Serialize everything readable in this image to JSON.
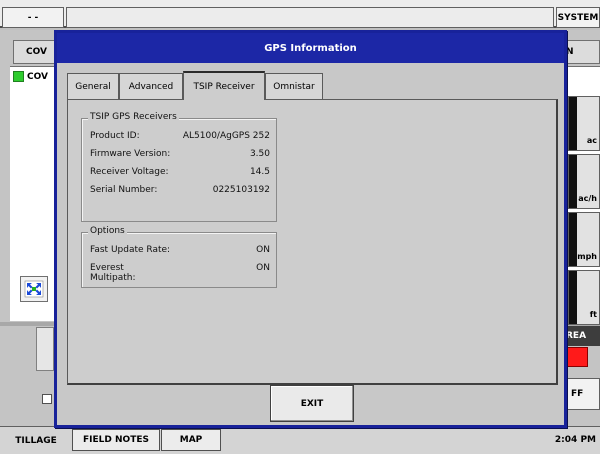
{
  "app": {
    "top_left_label": "- -",
    "system_label": "SYSTEM",
    "background_tab": "COV",
    "coverage_item": "COV",
    "header_right_fragment": "N",
    "right_units": [
      "ac",
      "ac/h",
      "mph",
      "ft"
    ],
    "area_label": "REA",
    "off_label": "FF",
    "clock": "2:04 PM",
    "bottom_tabs": [
      "TILLAGE",
      "FIELD NOTES",
      "MAP"
    ],
    "colors": {
      "dialog_blue": "#1c27a6",
      "coverage_green": "#2ecc2e",
      "area_red": "#ff1a1a"
    }
  },
  "dialog": {
    "title": "GPS Information",
    "tabs": [
      "General",
      "Advanced",
      "TSIP Receiver",
      "Omnistar"
    ],
    "active_tab": "TSIP Receiver",
    "receivers_group": {
      "title": "TSIP GPS Receivers",
      "rows": [
        {
          "label": "Product ID:",
          "value": "AL5100/AgGPS 252"
        },
        {
          "label": "Firmware Version:",
          "value": "3.50"
        },
        {
          "label": "Receiver Voltage:",
          "value": "14.5"
        },
        {
          "label": "Serial Number:",
          "value": "0225103192"
        }
      ]
    },
    "options_group": {
      "title": "Options",
      "rows": [
        {
          "label": "Fast Update Rate:",
          "value": "ON"
        },
        {
          "label": "Everest Multipath:",
          "value": "ON"
        }
      ]
    },
    "exit_label": "EXIT"
  }
}
